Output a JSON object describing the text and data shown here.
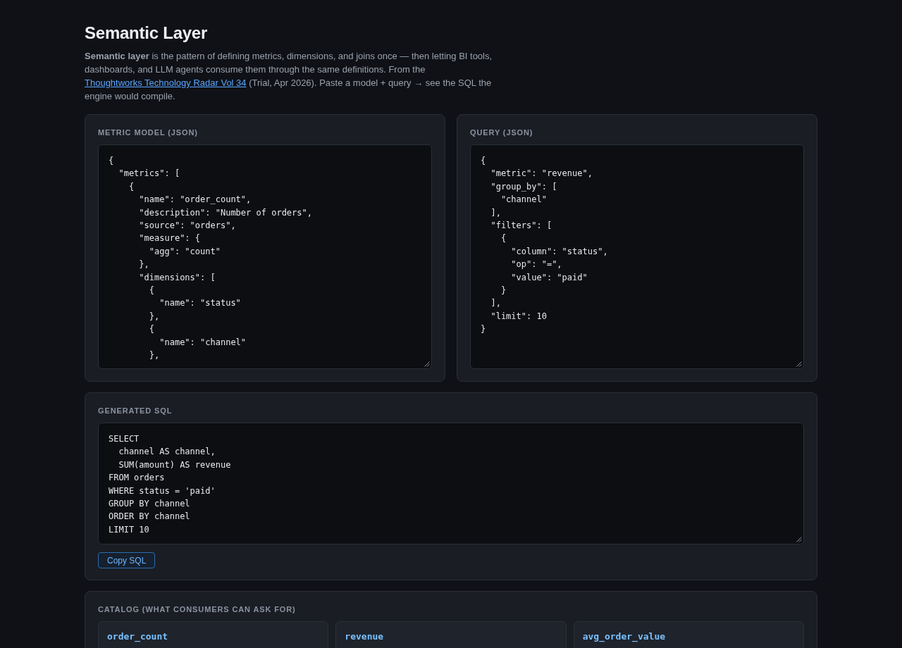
{
  "page": {
    "title": "Semantic Layer",
    "intro": {
      "text_before": "**Semantic layer** is the pattern of defining metrics, dimensions, and joins once — then letting BI tools, dashboards, and LLM agents consume them through the same definitions. From the",
      "link": "Thoughtworks Technology Radar Vol 34",
      "text_after": "(Trial, Apr 2026). Paste a model + query → see the SQL the engine would compile."
    }
  },
  "editors": [
    {
      "label": "METRIC MODEL (JSON)",
      "value": "{\n  \"metrics\": [\n    {\n      \"name\": \"order_count\",\n      \"description\": \"Number of orders\",\n      \"source\": \"orders\",\n      \"measure\": {\n        \"agg\": \"count\"\n      },\n      \"dimensions\": [\n        {\n          \"name\": \"status\"\n        },\n        {\n          \"name\": \"channel\"\n        },"
    },
    {
      "label": "QUERY (JSON)",
      "value": "{\n  \"metric\": \"revenue\",\n  \"group_by\": [\n    \"channel\"\n  ],\n  \"filters\": [\n    {\n      \"column\": \"status\",\n      \"op\": \"=\",\n      \"value\": \"paid\"\n    }\n  ],\n  \"limit\": 10\n}"
    }
  ],
  "generated_sql": {
    "label": "GENERATED SQL",
    "value": "SELECT\n  channel AS channel,\n  SUM(amount) AS revenue\nFROM orders\nWHERE status = 'paid'\nGROUP BY channel\nORDER BY channel\nLIMIT 10",
    "button": "Copy SQL"
  },
  "catalog": {
    "label": "CATALOG (WHAT CONSUMERS CAN ASK FOR)",
    "items": [
      {
        "name": "order_count"
      },
      {
        "name": "revenue"
      },
      {
        "name": "avg_order_value"
      }
    ]
  }
}
